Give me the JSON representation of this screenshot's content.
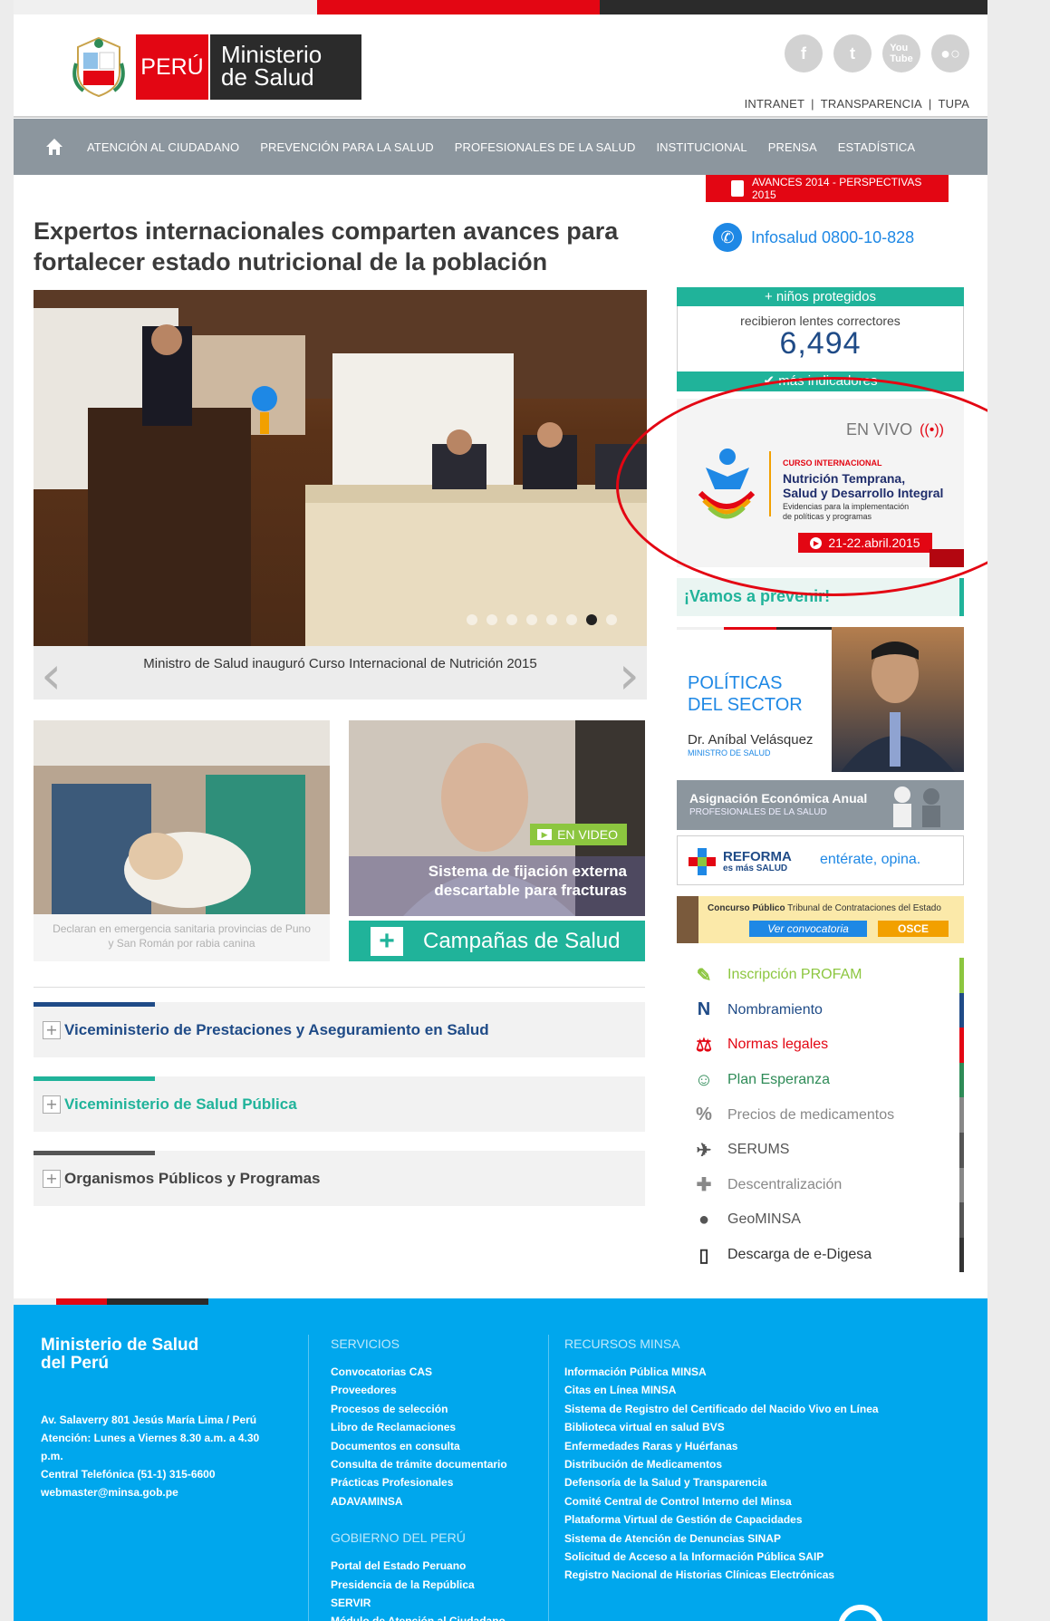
{
  "header": {
    "peru": "PERÚ",
    "ministerio_line1": "Ministerio",
    "ministerio_line2": "de Salud",
    "top_links": [
      "INTRANET",
      "TRANSPARENCIA",
      "TUPA"
    ],
    "social": [
      "facebook",
      "twitter",
      "youtube",
      "flickr"
    ]
  },
  "nav": {
    "items": [
      "ATENCIÓN AL CIUDADANO",
      "PREVENCIÓN PARA LA SALUD",
      "PROFESIONALES DE LA SALUD",
      "INSTITUCIONAL",
      "PRENSA",
      "ESTADÍSTICA"
    ]
  },
  "main": {
    "headline": "Expertos internacionales comparten avances para fortalecer estado nutricional de la población",
    "slider_caption": "Ministro de Salud inauguró Curso Internacional de Nutrición 2015",
    "slider_dots": 8,
    "slider_active": 6,
    "news1_caption": "Declaran en emergencia sanitaria provincias de Puno y San Román por rabia canina",
    "video_badge": "EN VIDEO",
    "video_title_1": "Sistema de fijación externa",
    "video_title_2": "descartable para fracturas",
    "campaign": "Campañas de Salud",
    "accordions": [
      {
        "title": "Viceministerio de Prestaciones y Aseguramiento en Salud",
        "color": "#1f4b87"
      },
      {
        "title": "Viceministerio de Salud Pública",
        "color": "#20b39a"
      },
      {
        "title": "Organismos Públicos y Programas",
        "color": "#555555"
      }
    ]
  },
  "sidebar": {
    "avances": "AVANCES 2014 - PERSPECTIVAS 2015",
    "infosalud": "Infosalud 0800-10-828",
    "indicator_head": "+ niños protegidos",
    "indicator_sub": "recibieron lentes correctores",
    "indicator_value": "6,494",
    "indicator_foot": "✔ más indicadores",
    "envivo": "EN VIVO",
    "curso_small": "CURSO INTERNACIONAL",
    "curso_title_1": "Nutrición Temprana,",
    "curso_title_2": "Salud y Desarrollo Integral",
    "curso_desc_1": "Evidencias para la implementación",
    "curso_desc_2": "de políticas y programas",
    "curso_date": "21-22.abril.2015",
    "vamos": "¡Vamos a prevenir!",
    "politicas_1": "POLÍTICAS",
    "politicas_2": "DEL SECTOR",
    "minister_name": "Dr. Aníbal Velásquez",
    "minister_role": "MINISTRO DE SALUD",
    "asignacion_1": "Asignación Económica Anual",
    "asignacion_2": "PROFESIONALES DE LA SALUD",
    "reforma_1": "REFORMA",
    "reforma_2": "es más SALUD",
    "reforma_3": "entérate, opina.",
    "concurso_bold": "Concurso Público",
    "concurso_rest": " Tribunal de Contrataciones del Estado",
    "concurso_btn": "Ver convocatoria",
    "osce": "OSCE",
    "links": [
      {
        "label": "Inscripción PROFAM",
        "icon": "pencil-icon",
        "glyph": "✎",
        "color": "#8cc63f"
      },
      {
        "label": "Nombramiento",
        "icon": "n-letter-icon",
        "glyph": "N",
        "color": "#1f4b87"
      },
      {
        "label": "Normas legales",
        "icon": "gavel-icon",
        "glyph": "⚖",
        "color": "#e30613"
      },
      {
        "label": "Plan Esperanza",
        "icon": "ribbon-icon",
        "glyph": "☺",
        "color": "#2e8b57"
      },
      {
        "label": "Precios de medicamentos",
        "icon": "pills-icon",
        "glyph": "%",
        "color": "#888888"
      },
      {
        "label": "SERUMS",
        "icon": "people-icon",
        "glyph": "✈",
        "color": "#555555"
      },
      {
        "label": "Descentralización",
        "icon": "map-peru-icon",
        "glyph": "✚",
        "color": "#888888"
      },
      {
        "label": "GeoMINSA",
        "icon": "location-pin-icon",
        "glyph": "●",
        "color": "#555555"
      },
      {
        "label": "Descarga de e-Digesa",
        "icon": "mobile-icon",
        "glyph": "▯",
        "color": "#333333"
      }
    ]
  },
  "footer": {
    "title_1": "Ministerio de Salud",
    "title_2": "del Perú",
    "address": "Av. Salaverry 801 Jesús María Lima / Perú",
    "hours": "Atención: Lunes a Viernes 8.30 a.m. a 4.30 p.m.",
    "phone": "Central Telefónica (51-1) 315-6600",
    "email": "webmaster@minsa.gob.pe",
    "servicios_title": "SERVICIOS",
    "servicios": [
      "Convocatorias CAS",
      "Proveedores",
      "Procesos de selección",
      "Libro de Reclamaciones",
      "Documentos en consulta",
      "Consulta de trámite documentario",
      "Prácticas Profesionales",
      "ADAVAMINSA"
    ],
    "gobierno_title": "GOBIERNO DEL PERÚ",
    "gobierno": [
      "Portal del Estado Peruano",
      "Presidencia de la República",
      "SERVIR",
      "Módulo de Atención al Ciudadano"
    ],
    "recursos_title": "RECURSOS MINSA",
    "recursos": [
      "Información Pública MINSA",
      "Citas en Línea MINSA",
      "Sistema de Registro del Certificado del Nacido Vivo en Línea",
      "Biblioteca virtual en salud BVS",
      "Enfermedades Raras y Huérfanas",
      "Distribución de Medicamentos",
      "Defensoría de la Salud y Transparencia",
      "Comité Central de Control Interno del Minsa",
      "Plataforma Virtual de Gestión de Capacidades",
      "Sistema de Atención de Denuncias SINAP",
      "Solicitud de Acceso a la Información Pública SAIP",
      "Registro Nacional de Historias Clínicas Electrónicas"
    ]
  }
}
